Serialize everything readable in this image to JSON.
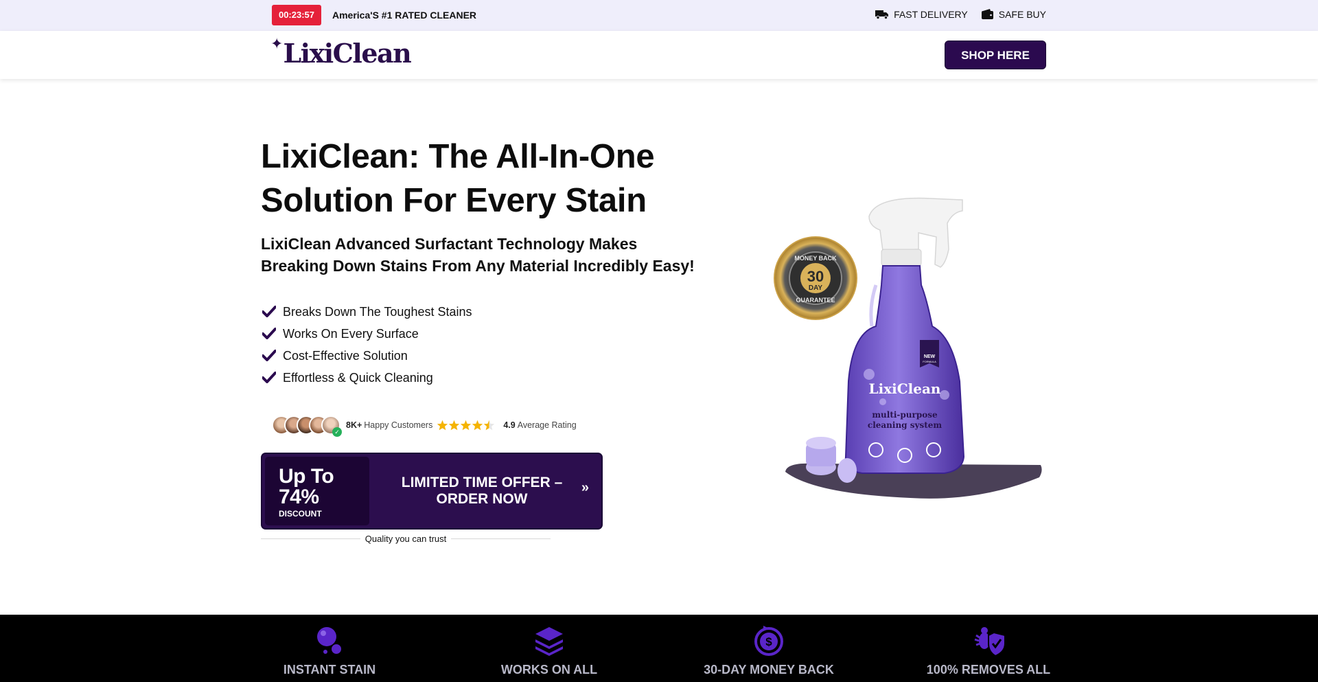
{
  "topbar": {
    "timer": "00:23:57",
    "rated": "America'S #1 RATED CLEANER",
    "delivery_label": "FAST DELIVERY",
    "delivery_icon": "truck-icon",
    "safe_label": "SAFE BUY",
    "safe_icon": "wallet-icon"
  },
  "header": {
    "logo_text": "LixiClean",
    "shop_button": "SHOP HERE"
  },
  "hero": {
    "title": "LixiClean: The All-In-One Solution For Every Stain",
    "subtitle": "LixiClean Advanced Surfactant Technology Makes Breaking Down Stains From Any Material Incredibly Easy!",
    "features": [
      "Breaks Down The Toughest Stains",
      "Works On Every Surface",
      "Cost-Effective Solution",
      "Effortless & Quick Cleaning"
    ],
    "customers_count": "8K+",
    "customers_label": "Happy Customers",
    "rating_value": "4.9",
    "rating_label": "Average Rating",
    "rating_stars": 4.5
  },
  "offer": {
    "big_line1": "Up To",
    "big_line2": "74%",
    "small": "DISCOUNT",
    "cta_line1": "LIMITED TIME OFFER –",
    "cta_line2": "ORDER NOW",
    "arrow": "»"
  },
  "quality": "Quality you can trust",
  "product": {
    "badge_top": "MONEY BACK",
    "badge_num": "30",
    "badge_day": "DAY",
    "badge_bottom": "GUARANTEE",
    "bottle_brand": "LixiClean",
    "bottle_line1": "multi-purpose",
    "bottle_line2": "cleaning system",
    "bottle_tag1": "NEW",
    "bottle_tag2": "FORMULA"
  },
  "band": [
    {
      "label": "INSTANT STAIN",
      "icon": "bubbles-icon"
    },
    {
      "label": "WORKS ON ALL",
      "icon": "layers-icon"
    },
    {
      "label": "30-DAY MONEY BACK",
      "icon": "dollar-refresh-icon"
    },
    {
      "label": "100% REMOVES ALL",
      "icon": "bug-shield-icon"
    }
  ],
  "colors": {
    "brand_purple": "#2b0a4f",
    "timer_red": "#e5213a",
    "accent_violet": "#5a25c9",
    "topbar_bg": "#efeefb"
  }
}
